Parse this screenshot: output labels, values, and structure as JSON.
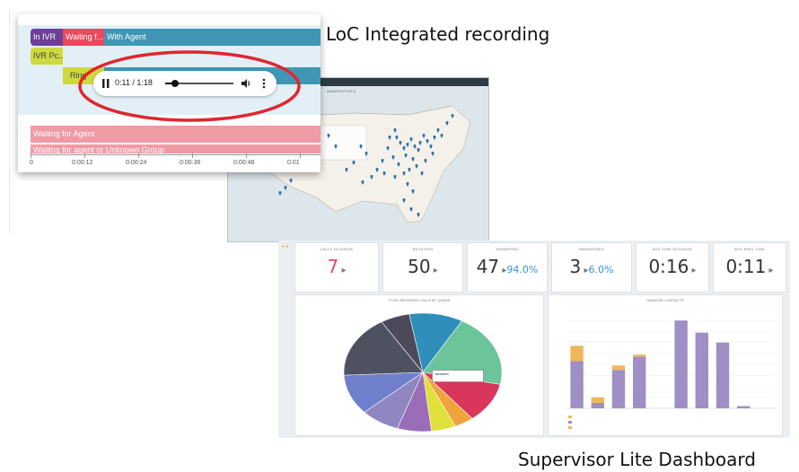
{
  "captions": {
    "top": "LoC Integrated recording",
    "bottom": "Supervisor Lite Dashboard"
  },
  "recording": {
    "bars": [
      {
        "label": "In IVR",
        "color": "#6e3f98"
      },
      {
        "label": "Waiting f...",
        "color": "#e8495e"
      },
      {
        "label": "With Agent",
        "color": "#3f97b5"
      },
      {
        "label": "IVR Pc...",
        "color": "#cfd83f"
      },
      {
        "label": "Ring",
        "color": "#cfd83f"
      },
      {
        "label": "Tal...",
        "color": "#3f97b5"
      },
      {
        "label": "Waiting for Agent",
        "color": "#f09aa6"
      },
      {
        "label": "Waiting for agent or Unknown Group",
        "color": "#f09aa6"
      }
    ],
    "ticks": [
      "0",
      "0:00:12",
      "0:00:24",
      "0:00:36",
      "0:00:48",
      "0:01"
    ],
    "player": {
      "time": "0:11 / 1:18",
      "progress": 0.14,
      "pause_icon": "pause-icon",
      "volume_icon": "volume-icon",
      "menu_icon": "more-vert-icon"
    },
    "highlight_color": "#e0262e"
  },
  "map": {
    "title": "AMAZON PLUS 8"
  },
  "dashboard": {
    "stats": [
      {
        "label": "CALLS IN QUEUE",
        "value": "7",
        "pct": "",
        "color": "#e8495e"
      },
      {
        "label": "RECEIVED",
        "value": "50",
        "pct": "",
        "color": "#333333"
      },
      {
        "label": "ANSWERED",
        "value": "47",
        "pct": "94.0%",
        "color": "#333333"
      },
      {
        "label": "ABANDONED",
        "value": "3",
        "pct": "6.0%",
        "color": "#333333"
      },
      {
        "label": "AVG TIME IN QUEUE",
        "value": "0:16",
        "pct": "",
        "color": "#333333"
      },
      {
        "label": "AVG RING TIME",
        "value": "0:11",
        "pct": "",
        "color": "#333333"
      }
    ],
    "pie_title": "TOTAL RECEIVED CALLS BY QUEUE",
    "bar_title": "HANDLED CONTACTS",
    "tooltip": "Jaratana"
  },
  "chart_data": [
    {
      "type": "pie",
      "title": "TOTAL RECEIVED CALLS BY QUEUE",
      "slices": [
        {
          "value": 6,
          "color": "#4a4a5a"
        },
        {
          "value": 11,
          "color": "#2f8fba"
        },
        {
          "value": 20,
          "color": "#6cc49a"
        },
        {
          "value": 11,
          "color": "#d8365a"
        },
        {
          "value": 4,
          "color": "#f0a33a"
        },
        {
          "value": 5,
          "color": "#dfe03a"
        },
        {
          "value": 7,
          "color": "#9b6db8"
        },
        {
          "value": 8,
          "color": "#8f86c2"
        },
        {
          "value": 11,
          "color": "#6f7fcc"
        },
        {
          "value": 17,
          "color": "#4e5260"
        }
      ]
    },
    {
      "type": "bar",
      "title": "HANDLED CONTACTS",
      "ylim": [
        0,
        90
      ],
      "series": [
        {
          "values": [
            43,
            5,
            35,
            47,
            0,
            80,
            69,
            60,
            2,
            0
          ],
          "color": "#9f8fc4"
        },
        {
          "values": [
            14,
            5,
            4,
            2,
            0,
            0,
            0,
            0,
            0,
            0
          ],
          "color": "#f0b65a"
        }
      ]
    }
  ]
}
